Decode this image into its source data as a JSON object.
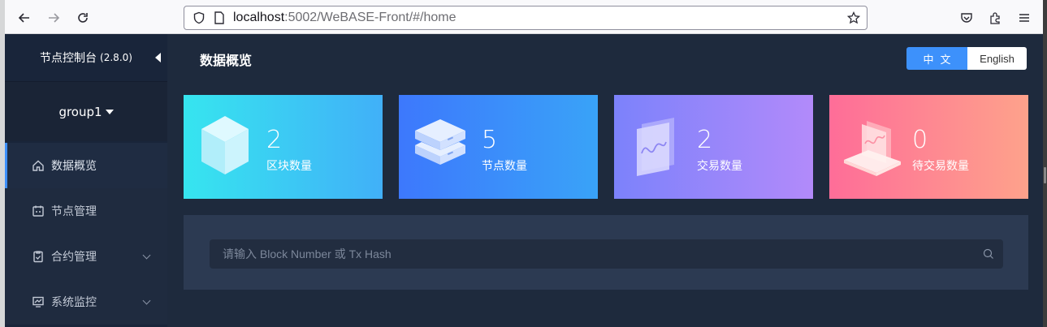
{
  "browser": {
    "url_host": "localhost",
    "url_rest": ":5002/WeBASE-Front/#/home"
  },
  "sidebar": {
    "title": "节点控制台",
    "version": "(2.8.0)",
    "group": "group1",
    "items": [
      {
        "label": "数据概览",
        "icon": "home-icon"
      },
      {
        "label": "节点管理",
        "icon": "calendar-icon"
      },
      {
        "label": "合约管理",
        "icon": "clipboard-icon"
      },
      {
        "label": "系统监控",
        "icon": "monitor-chart-icon"
      }
    ]
  },
  "header": {
    "title": "数据概览",
    "lang_zh": "中文",
    "lang_en": "English"
  },
  "cards": [
    {
      "value": "2",
      "label": "区块数量",
      "icon": "cube-icon",
      "color_from": "#36e3ef",
      "color_to": "#42b3f8"
    },
    {
      "value": "5",
      "label": "节点数量",
      "icon": "server-stack-icon",
      "color_from": "#3e7afc",
      "color_to": "#38a4f8"
    },
    {
      "value": "2",
      "label": "交易数量",
      "icon": "chart-panel-icon",
      "color_from": "#7c84fb",
      "color_to": "#b387fa"
    },
    {
      "value": "0",
      "label": "待交易数量",
      "icon": "chart-laptop-icon",
      "color_from": "#fe6f98",
      "color_to": "#fea08c"
    }
  ],
  "search": {
    "placeholder": "请输入 Block Number 或 Tx Hash"
  },
  "colors": {
    "accent": "#3d91fb",
    "sidebar_bg": "#19253a",
    "main_bg": "#1e2a3d"
  }
}
